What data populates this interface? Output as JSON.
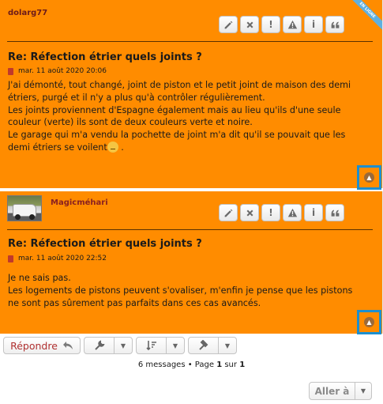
{
  "post_actions": {
    "edit": "pencil-icon",
    "delete": "times-icon",
    "report": "!",
    "warn": "warning-icon",
    "info": "i",
    "quote": "quote-icon"
  },
  "online_badge": "EN LIGNE",
  "posts": [
    {
      "author": "dolarg77",
      "title": "Re: Réfection étrier quels joints ?",
      "date": "mar. 11 août 2020 20:06",
      "lines": [
        "J'ai démonté, tout changé, joint de piston et le petit joint de maison des demi",
        "étriers, purgé et il n'y a plus qu'à contrôler régulièrement.",
        "Les joints proviennent d'Espagne également mais au lieu qu'ils d'une seule",
        "couleur (verte) ils sont de deux couleurs verte et noire.",
        "Le garage qui m'a vendu la pochette de joint m'a dit qu'il se pouvait que les",
        "demi étriers se voilent",
        " ."
      ]
    },
    {
      "author": "Magicméhari",
      "title": "Re: Réfection étrier quels joints ?",
      "date": "mar. 11 août 2020 22:52",
      "lines": [
        "Je ne sais pas.",
        "Les logements de pistons peuvent s'ovaliser, m'enfin je pense que les pistons",
        "ne sont pas sûrement pas parfaits dans ces cas avancés."
      ]
    }
  ],
  "toolbar": {
    "reply_label": "Répondre"
  },
  "pagination": {
    "count_text": "6 messages • Page ",
    "current": "1",
    "of_text": " sur ",
    "total": "1"
  },
  "jump": {
    "label": "Aller à"
  },
  "colors": {
    "post_bg": "#ff8c00",
    "highlight": "#1d8fcf",
    "reply": "#b03030"
  }
}
